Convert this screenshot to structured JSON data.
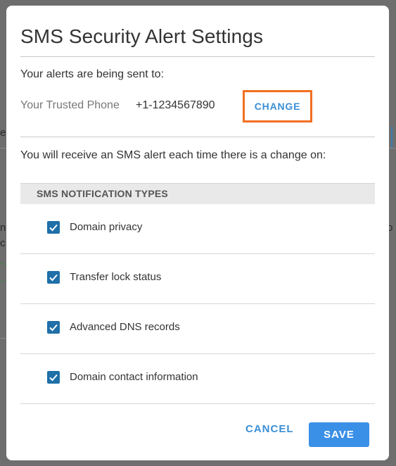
{
  "dialog": {
    "title": "SMS Security Alert Settings",
    "sent_to_label": "Your alerts are being sent to:",
    "phone_label": "Your Trusted Phone",
    "phone_number": "+1-1234567890",
    "change_label": "CHANGE",
    "intro": "You will receive an SMS alert each time there is a change on:",
    "types_header": "SMS NOTIFICATION TYPES",
    "types": [
      {
        "label": "Domain privacy",
        "checked": true
      },
      {
        "label": "Transfer lock status",
        "checked": true
      },
      {
        "label": "Advanced DNS records",
        "checked": true
      },
      {
        "label": "Domain contact information",
        "checked": true
      }
    ],
    "cancel_label": "CANCEL",
    "save_label": "SAVE"
  },
  "background": {
    "frag_left_1": "e",
    "frag_left_2": "no",
    "frag_left_3": "c",
    "frag_right_1": "to"
  },
  "colors": {
    "accent": "#3a8fd6",
    "highlight_border": "#f26f21",
    "checkbox": "#1f6fa8",
    "save_bg": "#3a8fe6",
    "backdrop": "#6e6e6e"
  },
  "icons": {
    "checkbox": "checkmark-icon"
  }
}
